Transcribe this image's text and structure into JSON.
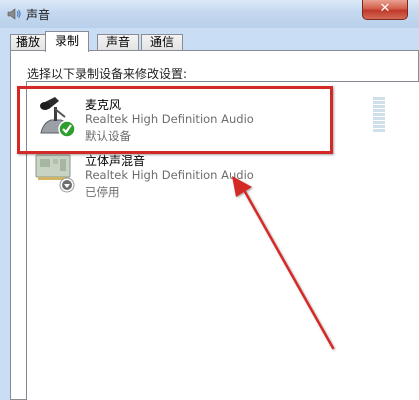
{
  "window": {
    "title": "声音",
    "close_glyph": "✕",
    "icon": "speaker-icon"
  },
  "tabs": [
    {
      "label": "播放",
      "active": false
    },
    {
      "label": "录制",
      "active": true
    },
    {
      "label": "声音",
      "active": false
    },
    {
      "label": "通信",
      "active": false
    }
  ],
  "instruction": "选择以下录制设备来修改设置:",
  "devices": [
    {
      "name": "麦克风",
      "description": "Realtek High Definition Audio",
      "status": "默认设备",
      "icon": "microphone-icon",
      "status_icon": "green-check-icon",
      "highlighted": true
    },
    {
      "name": "立体声混音",
      "description": "Realtek High Definition Audio",
      "status": "已停用",
      "icon": "sound-card-icon",
      "status_icon": "disabled-down-arrow-icon",
      "highlighted": false
    }
  ],
  "colors": {
    "annotation_red": "#d42a27",
    "window_frame": "#c9def5",
    "close_button": "#c0392b",
    "default_check": "#2e9e2e"
  }
}
